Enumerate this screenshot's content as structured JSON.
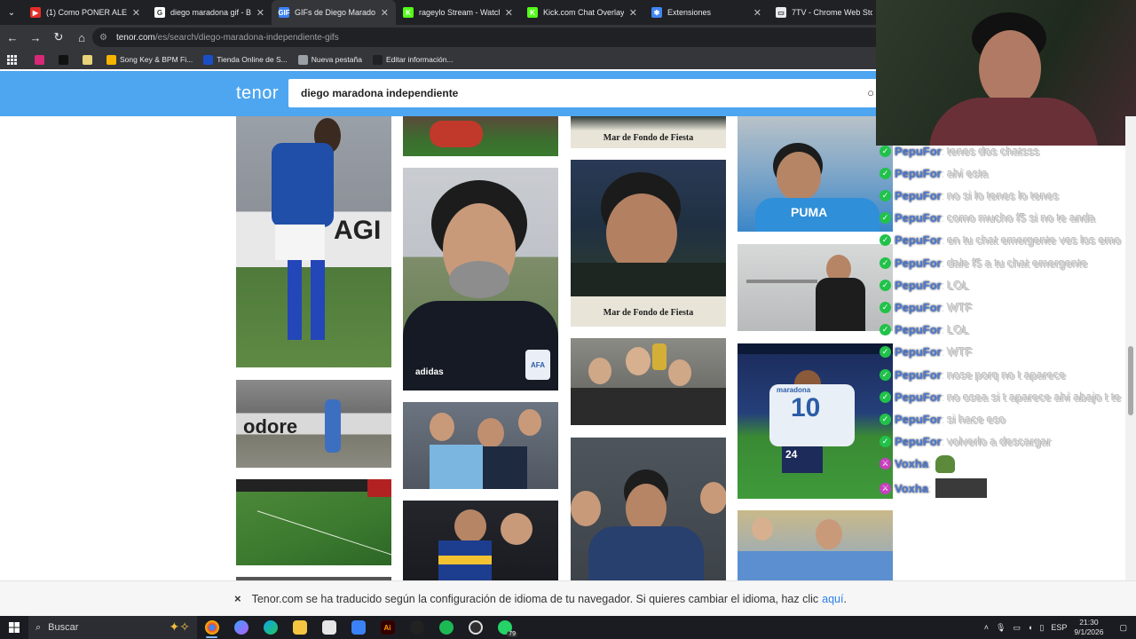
{
  "tabs": [
    {
      "title": "(1) Como PONER ALERTAS",
      "fav_color": "#e52d27",
      "fav_glyph": "▶",
      "active": false
    },
    {
      "title": "diego maradona gif - Bus",
      "fav_color": "#ffffff",
      "fav_glyph": "G",
      "active": false
    },
    {
      "title": "GIFs de Diego Maradona",
      "fav_color": "#3b82f6",
      "fav_glyph": "GIF",
      "active": true
    },
    {
      "title": "rageylo Stream - Watch L",
      "fav_color": "#53fc18",
      "fav_glyph": "K",
      "active": false
    },
    {
      "title": "Kick.com Chat Overlay",
      "fav_color": "#53fc18",
      "fav_glyph": "K",
      "active": false
    },
    {
      "title": "Extensiones",
      "fav_color": "#4285f4",
      "fav_glyph": "✱",
      "active": false
    },
    {
      "title": "7TV - Chrome Web Store",
      "fav_color": "#e8eaed",
      "fav_glyph": "▭",
      "active": false
    }
  ],
  "tab_close_glyph": "✕",
  "address_bar": {
    "domain": "tenor.com",
    "path": "/es/search/diego-maradona-independiente-gifs"
  },
  "bookmarks": [
    {
      "label": "",
      "color": "#d62976"
    },
    {
      "label": "",
      "color": "#111111"
    },
    {
      "label": "",
      "color": "#e8d27a"
    },
    {
      "label": "Song Key & BPM Fi...",
      "color": "#f4b400"
    },
    {
      "label": "Tienda Online de S...",
      "color": "#1a4fc4"
    },
    {
      "label": "Nueva pestaña",
      "color": "#9aa0a6"
    },
    {
      "label": "Editar información...",
      "color": "#202124"
    }
  ],
  "tenor": {
    "logo": "tenor",
    "search_value": "diego maradona independiente"
  },
  "gifs": {
    "caption_fiesta_1": "Mar de Fondo de Fiesta",
    "caption_fiesta_2": "Mar de Fondo de Fiesta",
    "caption_fiesta_3": "Mar de Fondo de Fiesta",
    "banner_text": "odore",
    "sponsor_text": "AGI",
    "jersey_name": "maradona",
    "jersey_number": "10",
    "jersey_number_2": "24",
    "shirt_text": "PUMA",
    "team_crest": "AFA",
    "brand": "adidas"
  },
  "chat": [
    {
      "user": "PepuFor",
      "text": "tenes dos chatsss",
      "badge": "green"
    },
    {
      "user": "PepuFor",
      "text": "ahí esta",
      "badge": "green"
    },
    {
      "user": "PepuFor",
      "text": "no si lo tenes lo tenes",
      "badge": "green"
    },
    {
      "user": "PepuFor",
      "text": "como mucho f5 si no te anda",
      "badge": "green"
    },
    {
      "user": "PepuFor",
      "text": "en tu chat emergente ves los emo",
      "badge": "green"
    },
    {
      "user": "PepuFor",
      "text": "dale f5 a tu chat emergente",
      "badge": "green"
    },
    {
      "user": "PepuFor",
      "text": "LOL",
      "badge": "green"
    },
    {
      "user": "PepuFor",
      "text": "WTF",
      "badge": "green"
    },
    {
      "user": "PepuFor",
      "text": "LOL",
      "badge": "green"
    },
    {
      "user": "PepuFor",
      "text": "WTF",
      "badge": "green"
    },
    {
      "user": "PepuFor",
      "text": "nose porq no t aparece",
      "badge": "green"
    },
    {
      "user": "PepuFor",
      "text": "no osea si t aparece ahí abajo t te",
      "badge": "green"
    },
    {
      "user": "PepuFor",
      "text": "si hace eso",
      "badge": "green"
    },
    {
      "user": "PepuFor",
      "text": "volverlo a descargar",
      "badge": "green"
    },
    {
      "user": "Voxha",
      "text": "",
      "badge": "pink",
      "emote": "pepe"
    },
    {
      "user": "Voxha",
      "text": "",
      "badge": "pink",
      "emote": "wide"
    }
  ],
  "chat_user_colors": {
    "PepuFor": "#4c7bd9",
    "Voxha": "#4c7bd9"
  },
  "notice": {
    "close": "×",
    "text": "Tenor.com se ha traducido según la configuración de idioma de tu navegador. Si quieres cambiar el idioma, haz clic",
    "link": "aquí",
    "after": "."
  },
  "taskbar": {
    "search_placeholder": "Buscar",
    "whatsapp_count": "79",
    "language": "ESP",
    "time": "21:30",
    "date": "9/1/2026"
  }
}
